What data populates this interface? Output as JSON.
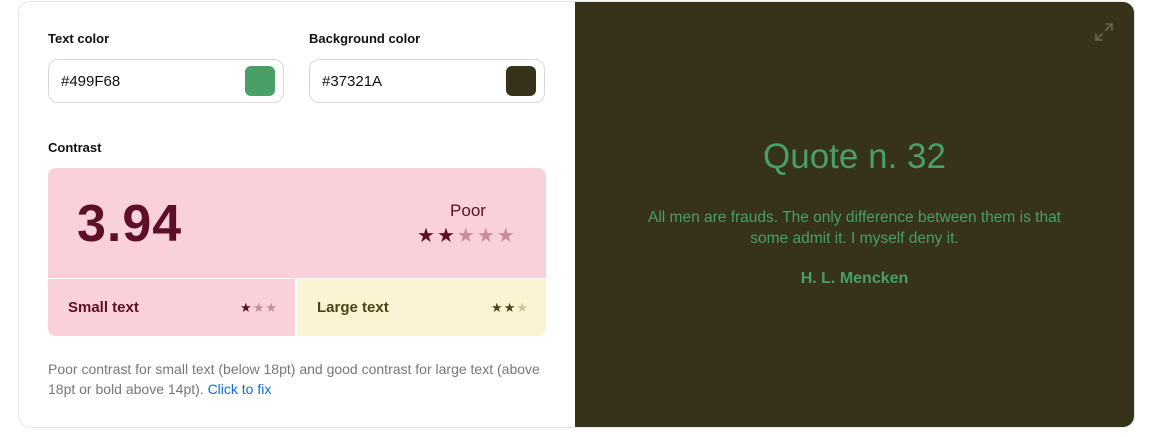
{
  "text_color": {
    "label": "Text color",
    "value": "#499F68",
    "swatch": "#499F68"
  },
  "background_color": {
    "label": "Background color",
    "value": "#37321A",
    "swatch": "#37321A"
  },
  "contrast": {
    "label": "Contrast",
    "ratio": "3.94",
    "rating": "Poor",
    "stars_filled": 2,
    "stars_total": 5,
    "small_text": {
      "label": "Small text",
      "stars_filled": 1,
      "stars_total": 3
    },
    "large_text": {
      "label": "Large text",
      "stars_filled": 2,
      "stars_total": 3
    }
  },
  "summary": {
    "text": "Poor contrast for small text (below 18pt) and good contrast for large text (above 18pt or bold above 14pt).",
    "fix_link": "Click to fix"
  },
  "preview": {
    "title": "Quote n. 32",
    "quote": "All men are frauds. The only difference between them is that some admit it. I myself deny it.",
    "author": "H. L. Mencken",
    "expand_icon": "expand-icon"
  },
  "colors": {
    "poor_bg": "#FAD1DA",
    "poor_fg": "#5C0F26",
    "good_bg": "#FBF4D2",
    "good_fg": "#4A4418",
    "link": "#1768D6"
  }
}
